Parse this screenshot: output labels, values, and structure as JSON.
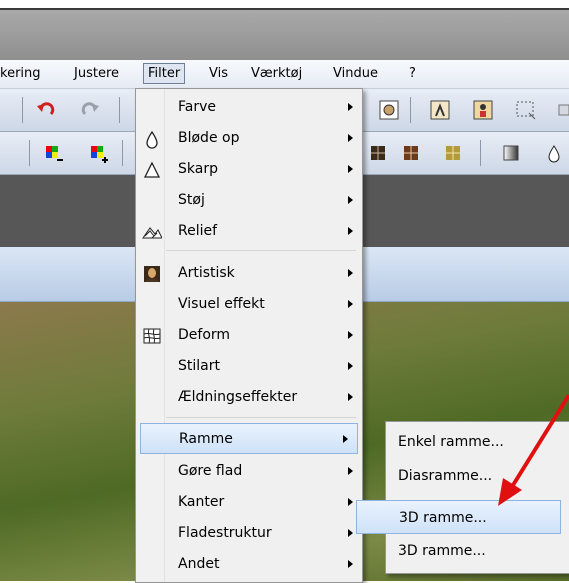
{
  "menubar": {
    "items": [
      "kering",
      "Justere",
      "Filter",
      "Vis",
      "Værktøj",
      "Vindue",
      "?"
    ]
  },
  "filter_menu": {
    "items": [
      {
        "label": "Farve",
        "icon": "none",
        "submenu": true
      },
      {
        "label": "Bløde op",
        "icon": "drop-outline-icon",
        "submenu": true
      },
      {
        "label": "Skarp",
        "icon": "triangle-outline-icon",
        "submenu": true
      },
      {
        "label": "Støj",
        "icon": "none",
        "submenu": true
      },
      {
        "label": "Relief",
        "icon": "relief-mountain-icon",
        "submenu": true
      },
      {
        "label": "Artistisk",
        "icon": "portrait-icon",
        "submenu": true
      },
      {
        "label": "Visuel effekt",
        "icon": "none",
        "submenu": true
      },
      {
        "label": "Deform",
        "icon": "grid-deform-icon",
        "submenu": true
      },
      {
        "label": "Stilart",
        "icon": "none",
        "submenu": true
      },
      {
        "label": "Ældningseffekter",
        "icon": "none",
        "submenu": true
      },
      {
        "label": "Ramme",
        "icon": "none",
        "submenu": true,
        "highlighted": true
      },
      {
        "label": "Gøre flad",
        "icon": "none",
        "submenu": true
      },
      {
        "label": "Kanter",
        "icon": "none",
        "submenu": true
      },
      {
        "label": "Fladestruktur",
        "icon": "none",
        "submenu": true
      },
      {
        "label": "Andet",
        "icon": "none",
        "submenu": true
      }
    ]
  },
  "submenu": {
    "items": [
      {
        "label": "Enkel ramme..."
      },
      {
        "label": "Diasramme..."
      },
      {
        "label": "3D ramme...",
        "highlighted": true
      },
      {
        "label": "3D ramme..."
      }
    ]
  },
  "annotation": {
    "arrow_color": "#e01010"
  },
  "colors": {
    "highlight": "#cfe2f8",
    "menu_bg": "#f0f0f0"
  }
}
